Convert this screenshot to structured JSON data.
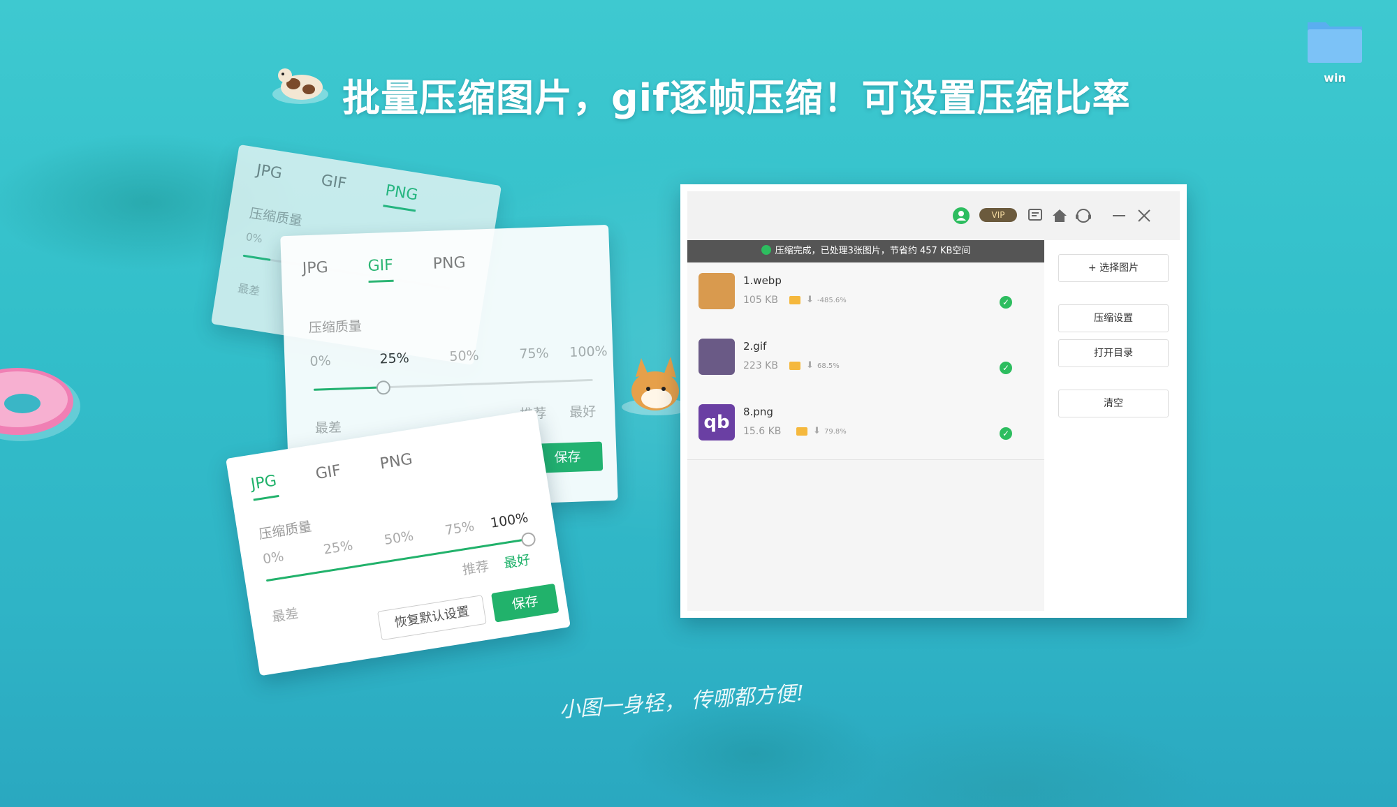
{
  "headline": "批量压缩图片，gif逐帧压缩！可设置压缩比率",
  "tagline": "小图一身轻， 传哪都方便!",
  "desktop": {
    "folder_label": "win"
  },
  "cards": {
    "png_card": {
      "tabs": [
        "JPG",
        "GIF",
        "PNG"
      ],
      "active_tab": "PNG",
      "quality_label": "压缩质量",
      "tick_0": "0%",
      "min_label": "最差"
    },
    "gif_card": {
      "tabs": [
        "JPG",
        "GIF",
        "PNG"
      ],
      "active_tab": "GIF",
      "quality_label": "压缩质量",
      "ticks": [
        "0%",
        "25%",
        "50%",
        "75%",
        "100%"
      ],
      "slider_value": 0.25,
      "min_label": "最差",
      "recommend_label": "推荐",
      "max_label": "最好",
      "save_label": "保存"
    },
    "jpg_card": {
      "tabs": [
        "JPG",
        "GIF",
        "PNG"
      ],
      "active_tab": "JPG",
      "quality_label": "压缩质量",
      "ticks": [
        "0%",
        "25%",
        "50%",
        "75%",
        "100%"
      ],
      "slider_value": 1.0,
      "min_label": "最差",
      "recommend_label": "推荐",
      "max_label": "最好",
      "reset_label": "恢复默认设置",
      "save_label": "保存"
    }
  },
  "app": {
    "titlebar": {
      "vip_label": "VIP",
      "icons": [
        "user-icon",
        "vip-badge-icon",
        "message-icon",
        "home-icon",
        "support-icon",
        "minimize-icon",
        "close-icon"
      ]
    },
    "status": "压缩完成，已处理3张图片，节省约 457 KB空间",
    "files": [
      {
        "name": "1.webp",
        "size": "105 KB",
        "ratio": "-485.6%",
        "thumb_color": "#d99a4e"
      },
      {
        "name": "2.gif",
        "size": "223 KB",
        "ratio": "68.5%",
        "thumb_color": "#6a5a86"
      },
      {
        "name": "8.png",
        "size": "15.6 KB",
        "ratio": "79.8%",
        "thumb_color": "#6a3fa3"
      }
    ],
    "side_buttons": {
      "select": "+ 选择图片",
      "settings": "压缩设置",
      "open_dir": "打开目录",
      "clear": "清空"
    }
  },
  "colors": {
    "accent": "#21b26b",
    "status_bg": "#555555",
    "ok": "#2dbd5f",
    "sea": "#33bfca"
  }
}
